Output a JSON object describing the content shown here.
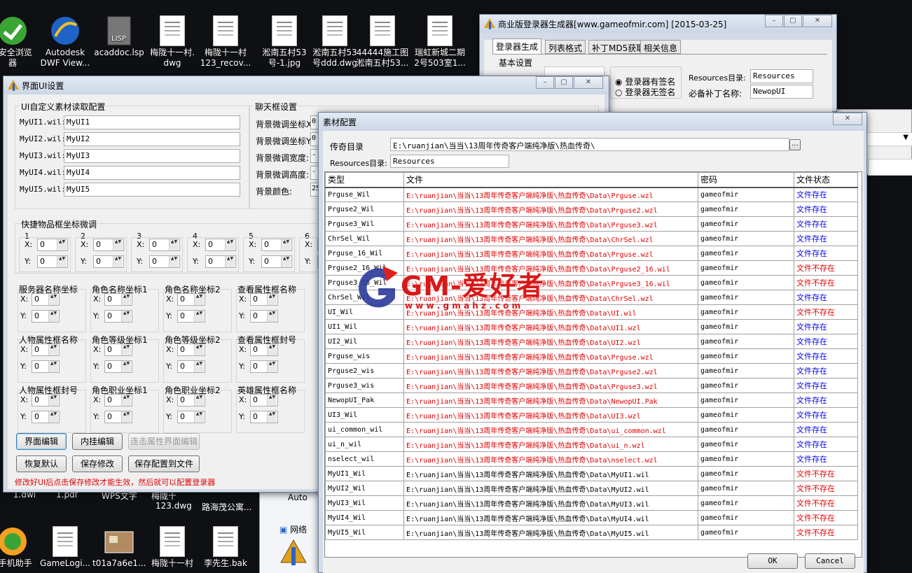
{
  "desktop_top": [
    {
      "label": "0安全浏览\n器",
      "icon": "browser-icon"
    },
    {
      "label": "Autodesk\nDWF View...",
      "icon": "autodesk-icon"
    },
    {
      "label": "acaddoc.lsp",
      "icon": "lisp-file-icon"
    },
    {
      "label": "梅陇十一村.\ndwg",
      "icon": "dwg-file-icon"
    },
    {
      "label": "梅陇十一村\n123_recov...",
      "icon": "dwg-file-icon"
    },
    {
      "label": "淞南五村53\n号-1.jpg",
      "icon": "jpg-file-icon"
    },
    {
      "label": "淞南五村53\n号ddd.dwg",
      "icon": "dwg-file-icon"
    },
    {
      "label": "44444施工图\n淞南五村53...",
      "icon": "file-icon"
    },
    {
      "label": "瑞虹新城二期\n2号503室1...",
      "icon": "dwg-file-icon"
    }
  ],
  "desktop_bottom": [
    {
      "label": "0手机助手",
      "icon": "phone-assistant-icon"
    },
    {
      "label": "GameLogi...",
      "icon": "text-file-icon"
    },
    {
      "label": "t01a7a6e1...",
      "icon": "image-file-icon"
    },
    {
      "label": "梅陇十一村",
      "icon": "file-icon"
    },
    {
      "label": "李先生.bak",
      "icon": "file-icon"
    }
  ],
  "desktop_partial": [
    "1.dwl",
    "1.pdf",
    "WPS文字",
    "梅陇十",
    "123.dwg",
    "路海茂公寓...",
    "Auto",
    "网络"
  ],
  "gen_window": {
    "title": "商业版登录器生成器[www.gameofmir.com] [2015-03-25]",
    "tabs": [
      "登录器生成",
      "列表格式",
      "补丁MD5获取",
      "相关信息"
    ],
    "group_label": "基本设置",
    "radio_signed": "登录器有签名",
    "radio_unsigned": "登录器无签名",
    "resources_label": "Resources目录:",
    "resources_value": "Resources",
    "patch_label": "必备补丁名称:",
    "patch_value": "NewopUI"
  },
  "ui_window": {
    "title": "界面UI设置",
    "group_custom": "UI自定义素材读取配置",
    "myui": [
      {
        "label": "MyUI1.wil:",
        "value": "MyUI1"
      },
      {
        "label": "MyUI2.wil:",
        "value": "MyUI2"
      },
      {
        "label": "MyUI3.wil:",
        "value": "MyUI3"
      },
      {
        "label": "MyUI4.wil:",
        "value": "MyUI4"
      },
      {
        "label": "MyUI5.wil:",
        "value": "MyUI5"
      }
    ],
    "group_chat": "聊天框设置",
    "chat": [
      {
        "label": "背景微调坐标X",
        "value": "0"
      },
      {
        "label": "背景微调坐标Y",
        "value": "0"
      },
      {
        "label": "背景微调宽度:",
        "value": "-"
      },
      {
        "label": "背景微调高度:",
        "value": "-"
      },
      {
        "label": "背景颜色:",
        "value": "25"
      }
    ],
    "group_quick": "快捷物品框坐标微调",
    "quick_slots": [
      "1",
      "2",
      "3",
      "4",
      "5",
      "6"
    ],
    "x_label": "X:",
    "y_label": "Y:",
    "zero": "0",
    "coord_groups": [
      "服务器名称坐标",
      "角色名称坐标1",
      "角色名称坐标2",
      "查看属性框名称",
      "人物属性框名称",
      "角色等级坐标1",
      "角色等级坐标2",
      "查看属性框封号",
      "人物属性框封号",
      "角色职业坐标1",
      "角色职业坐标2",
      "英雄属性框名称"
    ],
    "buttons_row1": [
      "界面编辑",
      "内挂编辑",
      "连击属性界面编辑"
    ],
    "buttons_row2": [
      "恢复默认",
      "保存修改",
      "保存配置到文件"
    ],
    "note": "修改好UI后点击保存修改才能生效，然后就可以配置登录器"
  },
  "material_window": {
    "title": "素材配置",
    "legend_dir_label": "传奇目录",
    "legend_dir_value": "E:\\ruanjian\\当当\\13周年传奇客户端纯净版\\热血传奇\\",
    "browse": "...",
    "res_label": "Resources目录:",
    "res_value": "Resources",
    "columns": [
      "类型",
      "文件",
      "密码",
      "文件状态"
    ],
    "rows": [
      {
        "type": "Prguse_Wil",
        "file": "E:\\ruanjian\\当当\\13周年传奇客户端纯净版\\热血传奇\\Data\\Prguse.wzl",
        "pw": "gameofmir",
        "status": "文件存在",
        "red": true
      },
      {
        "type": "Prguse2_Wil",
        "file": "E:\\ruanjian\\当当\\13周年传奇客户端纯净版\\热血传奇\\Data\\Prguse2.wzl",
        "pw": "gameofmir",
        "status": "文件存在",
        "red": true
      },
      {
        "type": "Prguse3_Wil",
        "file": "E:\\ruanjian\\当当\\13周年传奇客户端纯净版\\热血传奇\\Data\\Prguse3.wzl",
        "pw": "gameofmir",
        "status": "文件存在",
        "red": true
      },
      {
        "type": "ChrSel_Wil",
        "file": "E:\\ruanjian\\当当\\13周年传奇客户端纯净版\\热血传奇\\Data\\ChrSel.wzl",
        "pw": "gameofmir",
        "status": "文件存在",
        "red": true
      },
      {
        "type": "Prguse_16_Wil",
        "file": "E:\\ruanjian\\当当\\13周年传奇客户端纯净版\\热血传奇\\Data\\Prguse.wzl",
        "pw": "gameofmir",
        "status": "文件存在",
        "red": true
      },
      {
        "type": "Prguse2_16_Wil",
        "file": "E:\\ruanjian\\当当\\13周年传奇客户端纯净版\\热血传奇\\Data\\Prguse2_16.wil",
        "pw": "gameofmir",
        "status": "文件不存在",
        "red": true
      },
      {
        "type": "Prguse3_16_Wil",
        "file": "E:\\ruanjian\\当当\\13周年传奇客户端纯净版\\热血传奇\\Data\\Prguse3_16.wil",
        "pw": "gameofmir",
        "status": "文件不存在",
        "red": true
      },
      {
        "type": "ChrSel_Wil",
        "file": "E:\\ruanjian\\当当\\13周年传奇客户端纯净版\\热血传奇\\Data\\ChrSel.wzl",
        "pw": "gameofmir",
        "status": "文件存在",
        "red": true
      },
      {
        "type": "UI_Wil",
        "file": "E:\\ruanjian\\当当\\13周年传奇客户端纯净版\\热血传奇\\Data\\UI.wil",
        "pw": "gameofmir",
        "status": "文件不存在",
        "red": true
      },
      {
        "type": "UI1_Wil",
        "file": "E:\\ruanjian\\当当\\13周年传奇客户端纯净版\\热血传奇\\Data\\UI1.wzl",
        "pw": "gameofmir",
        "status": "文件存在",
        "red": true
      },
      {
        "type": "UI2_Wil",
        "file": "E:\\ruanjian\\当当\\13周年传奇客户端纯净版\\热血传奇\\Data\\UI2.wzl",
        "pw": "gameofmir",
        "status": "文件存在",
        "red": true
      },
      {
        "type": "Prguse_wis",
        "file": "E:\\ruanjian\\当当\\13周年传奇客户端纯净版\\热血传奇\\Data\\Prguse.wzl",
        "pw": "gameofmir",
        "status": "文件存在",
        "red": true
      },
      {
        "type": "Prguse2_wis",
        "file": "E:\\ruanjian\\当当\\13周年传奇客户端纯净版\\热血传奇\\Data\\Prguse2.wzl",
        "pw": "gameofmir",
        "status": "文件存在",
        "red": true
      },
      {
        "type": "Prguse3_wis",
        "file": "E:\\ruanjian\\当当\\13周年传奇客户端纯净版\\热血传奇\\Data\\Prguse3.wzl",
        "pw": "gameofmir",
        "status": "文件存在",
        "red": true
      },
      {
        "type": "NewopUI_Pak",
        "file": "E:\\ruanjian\\当当\\13周年传奇客户端纯净版\\热血传奇\\Data\\NewopUI.Pak",
        "pw": "gameofmir",
        "status": "文件存在",
        "red": true
      },
      {
        "type": "UI3_Wil",
        "file": "E:\\ruanjian\\当当\\13周年传奇客户端纯净版\\热血传奇\\Data\\UI3.wzl",
        "pw": "gameofmir",
        "status": "文件存在",
        "red": true
      },
      {
        "type": "ui_common_wil",
        "file": "E:\\ruanjian\\当当\\13周年传奇客户端纯净版\\热血传奇\\Data\\ui_common.wzl",
        "pw": "gameofmir",
        "status": "文件存在",
        "red": true
      },
      {
        "type": "ui_n_wil",
        "file": "E:\\ruanjian\\当当\\13周年传奇客户端纯净版\\热血传奇\\Data\\ui_n.wzl",
        "pw": "gameofmir",
        "status": "文件存在",
        "red": true
      },
      {
        "type": "nselect_wil",
        "file": "E:\\ruanjian\\当当\\13周年传奇客户端纯净版\\热血传奇\\Data\\nselect.wzl",
        "pw": "gameofmir",
        "status": "文件存在",
        "red": true
      },
      {
        "type": "MyUI1_Wil",
        "file": "E:\\ruanjian\\当当\\13周年传奇客户端纯净版\\热血传奇\\Data\\MyUI1.wil",
        "pw": "gameofmir",
        "status": "文件不存在",
        "red": false
      },
      {
        "type": "MyUI2_Wil",
        "file": "E:\\ruanjian\\当当\\13周年传奇客户端纯净版\\热血传奇\\Data\\MyUI2.wil",
        "pw": "gameofmir",
        "status": "文件不存在",
        "red": false
      },
      {
        "type": "MyUI3_Wil",
        "file": "E:\\ruanjian\\当当\\13周年传奇客户端纯净版\\热血传奇\\Data\\MyUI3.wil",
        "pw": "gameofmir",
        "status": "文件不存在",
        "red": false
      },
      {
        "type": "MyUI4_Wil",
        "file": "E:\\ruanjian\\当当\\13周年传奇客户端纯净版\\热血传奇\\Data\\MyUI4.wil",
        "pw": "gameofmir",
        "status": "文件不存在",
        "red": false
      },
      {
        "type": "MyUI5_Wil",
        "file": "E:\\ruanjian\\当当\\13周年传奇客户端纯净版\\热血传奇\\Data\\MyUI5.wil",
        "pw": "gameofmir",
        "status": "文件不存在",
        "red": false
      }
    ],
    "ok": "OK",
    "cancel": "Cancel"
  },
  "watermark": {
    "text": "GM-爱好者",
    "url": "w w w . g m a h z . c o m"
  },
  "colors": {
    "exists": "#0000e0",
    "missing": "#e00000",
    "path_red": "#e00000"
  }
}
